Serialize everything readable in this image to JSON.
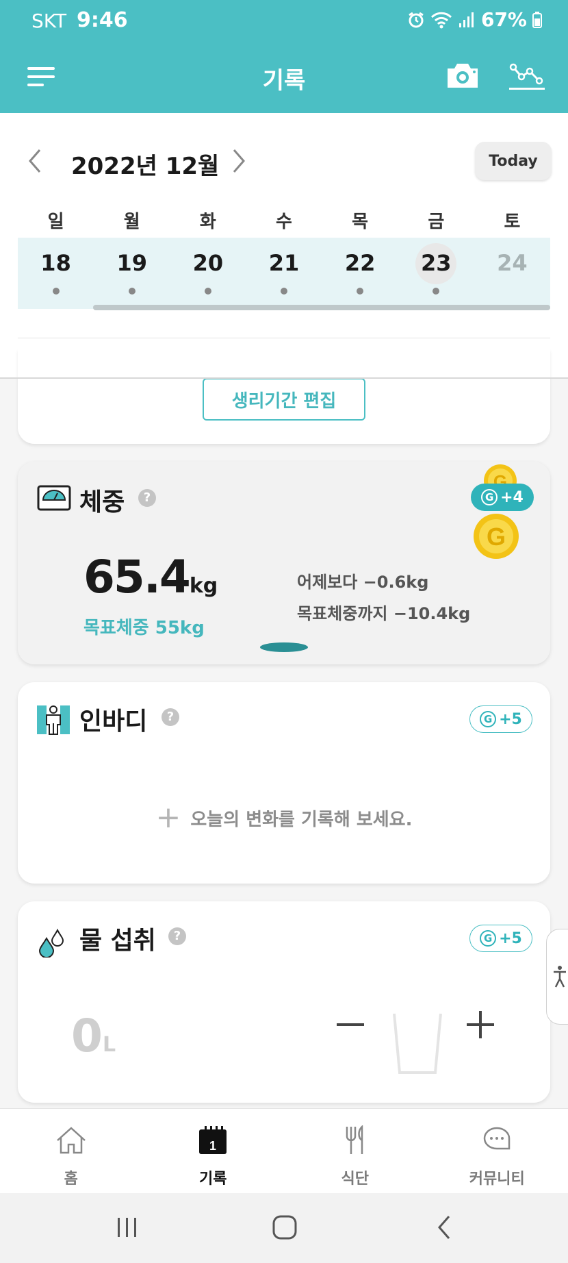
{
  "status_bar": {
    "carrier": "SKT",
    "time": "9:46",
    "battery": "67%"
  },
  "header": {
    "title": "기록",
    "icons": [
      "menu-icon",
      "camera-icon",
      "graph-icon"
    ]
  },
  "calendar": {
    "month_label": "2022년 12월",
    "today_label": "Today",
    "weekdays": [
      "일",
      "월",
      "화",
      "수",
      "목",
      "금",
      "토"
    ],
    "days": [
      {
        "num": "18",
        "has_dot": true
      },
      {
        "num": "19",
        "has_dot": true
      },
      {
        "num": "20",
        "has_dot": true
      },
      {
        "num": "21",
        "has_dot": true
      },
      {
        "num": "22",
        "has_dot": true
      },
      {
        "num": "23",
        "has_dot": true,
        "selected": true
      },
      {
        "num": "24",
        "has_dot": false,
        "future": true
      }
    ]
  },
  "period": {
    "edit_label": "생리기간 편집"
  },
  "weight": {
    "title": "체중",
    "help": "?",
    "reward": "+4",
    "value": "65.4",
    "unit": "kg",
    "goal": "목표체중 55kg",
    "vs_yesterday": "어제보다 −0.6kg",
    "to_goal": "목표체중까지 −10.4kg"
  },
  "inbody": {
    "title": "인바디",
    "help": "?",
    "reward": "+5",
    "add_prompt": "오늘의 변화를 기록해 보세요."
  },
  "water": {
    "title": "물 섭취",
    "help": "?",
    "reward": "+5",
    "value": "0",
    "unit": "L"
  },
  "reward_badge_letter": "G",
  "bottom_nav": [
    {
      "label": "홈",
      "icon": "home-icon",
      "active": false
    },
    {
      "label": "기록",
      "icon": "calendar-icon",
      "active": true,
      "icon_text": "1"
    },
    {
      "label": "식단",
      "icon": "utensils-icon",
      "active": false
    },
    {
      "label": "커뮤니티",
      "icon": "chat-icon",
      "active": false
    }
  ],
  "colors": {
    "accent": "#4bbfc4",
    "accent_dark": "#2fb3ba",
    "coin": "#f3c316"
  }
}
